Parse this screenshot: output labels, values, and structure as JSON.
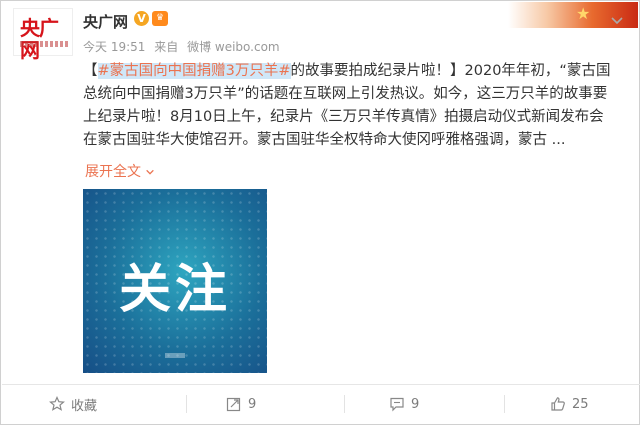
{
  "header": {
    "avatar_text": "央广网",
    "username": "央广网",
    "verified_icon": "verified-badge-icon",
    "level_icon": "member-level-icon",
    "time": "今天 19:51",
    "source_prefix": "来自",
    "source": "微博 weibo.com"
  },
  "post": {
    "bracket_open": "【",
    "topic": "#蒙古国向中国捐赠3万只羊#",
    "after_topic": "的故事要拍成纪录片啦！】2020年年初，“蒙古国总统向中国捐赠3万只羊”的话题在互联网上引发热议。如今，这三万只羊的故事要上纪录片啦！8月10日上午，纪录片《三万只羊传真情》拍摄启动仪式新闻发布会在蒙古国驻华大使馆召开。蒙古国驻华全权特命大使冈呼雅格强调，蒙古 ...",
    "expand_label": "展开全文",
    "expand_icon": "chevron-down-icon"
  },
  "media": {
    "text": "关注",
    "colors": {
      "center": "#2ea6c0",
      "edge": "#164e86"
    }
  },
  "actions": {
    "favorite_label": "收藏",
    "repost_count": "9",
    "comment_count": "9",
    "like_count": "25"
  },
  "colors": {
    "topic": "#eb7350",
    "topic_highlight": "#cfe7f8",
    "meta": "#999999",
    "brand_red": "#d6141b"
  }
}
